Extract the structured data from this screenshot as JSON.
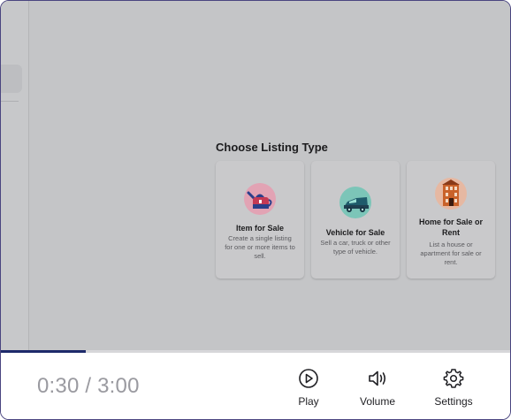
{
  "listing": {
    "title": "Choose Listing Type",
    "cards": [
      {
        "title": "Item for Sale",
        "desc": "Create a single listing for one or more items to sell.",
        "icon": "teapot-icon"
      },
      {
        "title": "Vehicle for Sale",
        "desc": "Sell a car, truck or other type of vehicle.",
        "icon": "car-icon"
      },
      {
        "title": "Home for Sale or Rent",
        "desc": "List a house or apartment for sale or rent.",
        "icon": "house-icon"
      }
    ]
  },
  "player": {
    "time": "0:30 / 3:00",
    "progress": 0.1667,
    "controls": {
      "play": "Play",
      "volume": "Volume",
      "settings": "Settings"
    }
  },
  "colors": {
    "accent": "#1d2a6b",
    "frame_border": "#4a4580"
  }
}
